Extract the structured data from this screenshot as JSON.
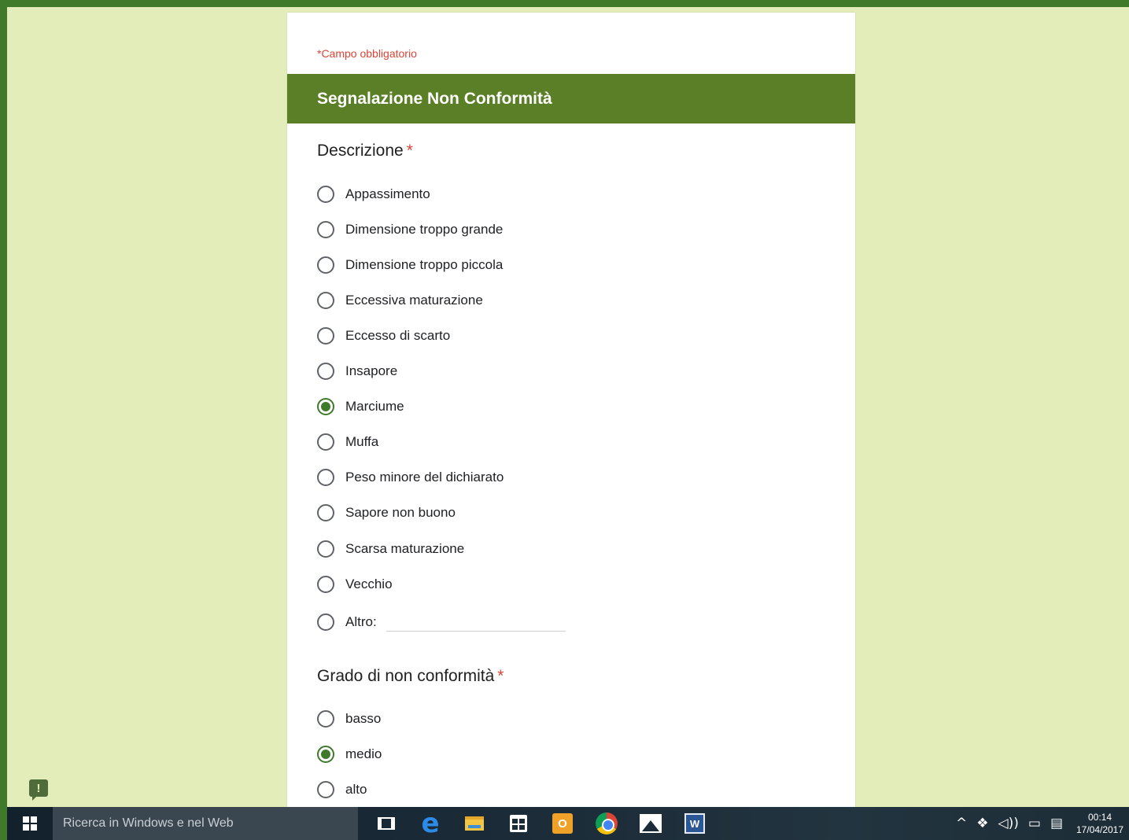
{
  "form": {
    "required_note": "*Campo obbligatorio",
    "section_title": "Segnalazione Non Conformità",
    "questions": [
      {
        "title": "Descrizione",
        "required_mark": "*",
        "options": [
          {
            "label": "Appassimento",
            "selected": false
          },
          {
            "label": "Dimensione troppo grande",
            "selected": false
          },
          {
            "label": "Dimensione troppo piccola",
            "selected": false
          },
          {
            "label": "Eccessiva maturazione",
            "selected": false
          },
          {
            "label": "Eccesso di scarto",
            "selected": false
          },
          {
            "label": "Insapore",
            "selected": false
          },
          {
            "label": "Marciume",
            "selected": true
          },
          {
            "label": "Muffa",
            "selected": false
          },
          {
            "label": "Peso minore del dichiarato",
            "selected": false
          },
          {
            "label": "Sapore non buono",
            "selected": false
          },
          {
            "label": "Scarsa maturazione",
            "selected": false
          },
          {
            "label": "Vecchio",
            "selected": false
          }
        ],
        "other_option": {
          "label": "Altro:",
          "value": "",
          "selected": false
        }
      },
      {
        "title": "Grado di non conformità",
        "required_mark": "*",
        "options": [
          {
            "label": "basso",
            "selected": false
          },
          {
            "label": "medio",
            "selected": true
          },
          {
            "label": "alto",
            "selected": false
          }
        ]
      }
    ]
  },
  "feedback_icon": {
    "glyph": "!"
  },
  "taskbar": {
    "search_placeholder": "Ricerca in Windows e nel Web",
    "pinned_apps": [
      "task-view-icon",
      "edge-icon",
      "file-explorer-icon",
      "store-icon",
      "outlook-icon",
      "chrome-icon",
      "photos-icon",
      "word-icon"
    ],
    "outlook_glyph": "O",
    "word_glyph": "W",
    "edge_glyph": "e",
    "tray": {
      "chevron": "^",
      "volume": "🔊",
      "clock_time": "00:14",
      "clock_date": "17/04/2017"
    }
  },
  "colors": {
    "background": "#e3edb9",
    "accent": "#5b7f27",
    "frame": "#3f7a2b",
    "required": "#db4437"
  }
}
